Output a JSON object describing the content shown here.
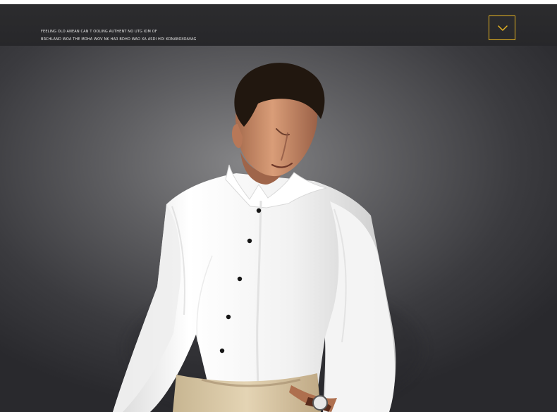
{
  "header": {
    "line_1": "FEELING OLO ANEAN CAN T OOLING AUTHENT NO UTG IOM OF",
    "line_2": "BRCHLAND WOA THE MOHA WOV NK HAR BDHO WAO XA ASDI HOI KONABOXOAVAG"
  },
  "icons": {
    "dropdown": "chevron-down-icon",
    "hero": "model-wearing-white-dress-shirt"
  },
  "colors": {
    "header_background": "#2b2b2d",
    "accent": "#e6b322",
    "hero_background": "#4a4a4e",
    "shirt": "#f8f8f8",
    "pants": "#d8c9aa"
  }
}
